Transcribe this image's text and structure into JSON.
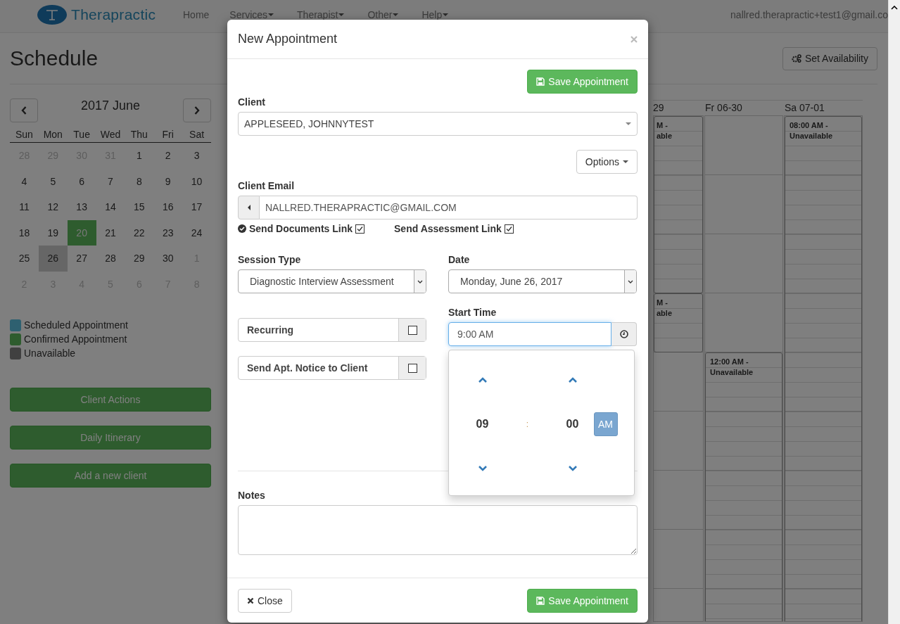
{
  "nav": {
    "brand": "Therapractic",
    "items": [
      {
        "label": "Home",
        "dropdown": false
      },
      {
        "label": "Services",
        "dropdown": true
      },
      {
        "label": "Therapist",
        "dropdown": true
      },
      {
        "label": "Other",
        "dropdown": true
      },
      {
        "label": "Help",
        "dropdown": true
      }
    ],
    "user": "nallred.therapractic+test1@gmail.co"
  },
  "page": {
    "title": "Schedule",
    "set_availability": "Set Availability"
  },
  "mini_calendar": {
    "title": "2017 June",
    "weekdays": [
      "Sun",
      "Mon",
      "Tue",
      "Wed",
      "Thu",
      "Fri",
      "Sat"
    ],
    "weeks": [
      [
        {
          "day": "28",
          "muted": true,
          "today": false,
          "selected": false
        },
        {
          "day": "29",
          "muted": true,
          "today": false,
          "selected": false
        },
        {
          "day": "30",
          "muted": true,
          "today": false,
          "selected": false
        },
        {
          "day": "31",
          "muted": true,
          "today": false,
          "selected": false
        },
        {
          "day": "1",
          "muted": false,
          "today": false,
          "selected": false
        },
        {
          "day": "2",
          "muted": false,
          "today": false,
          "selected": false
        },
        {
          "day": "3",
          "muted": false,
          "today": false,
          "selected": false
        }
      ],
      [
        {
          "day": "4",
          "muted": false,
          "today": false,
          "selected": false
        },
        {
          "day": "5",
          "muted": false,
          "today": false,
          "selected": false
        },
        {
          "day": "6",
          "muted": false,
          "today": false,
          "selected": false
        },
        {
          "day": "7",
          "muted": false,
          "today": false,
          "selected": false
        },
        {
          "day": "8",
          "muted": false,
          "today": false,
          "selected": false
        },
        {
          "day": "9",
          "muted": false,
          "today": false,
          "selected": false
        },
        {
          "day": "10",
          "muted": false,
          "today": false,
          "selected": false
        }
      ],
      [
        {
          "day": "11",
          "muted": false,
          "today": false,
          "selected": false
        },
        {
          "day": "12",
          "muted": false,
          "today": false,
          "selected": false
        },
        {
          "day": "13",
          "muted": false,
          "today": false,
          "selected": false
        },
        {
          "day": "14",
          "muted": false,
          "today": false,
          "selected": false
        },
        {
          "day": "15",
          "muted": false,
          "today": false,
          "selected": false
        },
        {
          "day": "16",
          "muted": false,
          "today": false,
          "selected": false
        },
        {
          "day": "17",
          "muted": false,
          "today": false,
          "selected": false
        }
      ],
      [
        {
          "day": "18",
          "muted": false,
          "today": false,
          "selected": false
        },
        {
          "day": "19",
          "muted": false,
          "today": false,
          "selected": false
        },
        {
          "day": "20",
          "muted": false,
          "today": true,
          "selected": false
        },
        {
          "day": "21",
          "muted": false,
          "today": false,
          "selected": false
        },
        {
          "day": "22",
          "muted": false,
          "today": false,
          "selected": false
        },
        {
          "day": "23",
          "muted": false,
          "today": false,
          "selected": false
        },
        {
          "day": "24",
          "muted": false,
          "today": false,
          "selected": false
        }
      ],
      [
        {
          "day": "25",
          "muted": false,
          "today": false,
          "selected": false
        },
        {
          "day": "26",
          "muted": false,
          "today": false,
          "selected": true
        },
        {
          "day": "27",
          "muted": false,
          "today": false,
          "selected": false
        },
        {
          "day": "28",
          "muted": false,
          "today": false,
          "selected": false
        },
        {
          "day": "29",
          "muted": false,
          "today": false,
          "selected": false
        },
        {
          "day": "30",
          "muted": false,
          "today": false,
          "selected": false
        },
        {
          "day": "1",
          "muted": true,
          "today": false,
          "selected": false
        }
      ],
      [
        {
          "day": "2",
          "muted": true,
          "today": false,
          "selected": false
        },
        {
          "day": "3",
          "muted": true,
          "today": false,
          "selected": false
        },
        {
          "day": "4",
          "muted": true,
          "today": false,
          "selected": false
        },
        {
          "day": "5",
          "muted": true,
          "today": false,
          "selected": false
        },
        {
          "day": "6",
          "muted": true,
          "today": false,
          "selected": false
        },
        {
          "day": "7",
          "muted": true,
          "today": false,
          "selected": false
        },
        {
          "day": "8",
          "muted": true,
          "today": false,
          "selected": false
        }
      ]
    ]
  },
  "legend": [
    {
      "label": "Scheduled Appointment",
      "color": "#2e6070"
    },
    {
      "label": "Confirmed Appointment",
      "color": "#2e5c2e"
    },
    {
      "label": "Unavailable",
      "color": "#404040"
    }
  ],
  "side_buttons": [
    "Client Actions",
    "Daily Itinerary",
    "Add a new client"
  ],
  "week_view": {
    "columns": [
      {
        "header": "29",
        "slots": [
          {
            "kind": "event",
            "text": "M -\nable"
          },
          {
            "kind": "continued"
          },
          {
            "kind": "continued"
          },
          {
            "kind": "event",
            "text": "M -\nable"
          },
          {
            "kind": "free"
          },
          {
            "kind": "free"
          },
          {
            "kind": "free"
          },
          {
            "kind": "free"
          },
          {
            "kind": "free"
          }
        ]
      },
      {
        "header": "Fr 06-30",
        "slots": [
          {
            "kind": "free"
          },
          {
            "kind": "free"
          },
          {
            "kind": "free"
          },
          {
            "kind": "free"
          },
          {
            "kind": "event",
            "text": "12:00 AM - Unavailable"
          },
          {
            "kind": "continued"
          },
          {
            "kind": "continued"
          },
          {
            "kind": "continued"
          },
          {
            "kind": "continued"
          }
        ]
      },
      {
        "header": "Sa 07-01",
        "slots": [
          {
            "kind": "event",
            "text": "08:00 AM - Unavailable"
          },
          {
            "kind": "continued"
          },
          {
            "kind": "continued"
          },
          {
            "kind": "continued"
          },
          {
            "kind": "continued"
          },
          {
            "kind": "continued"
          },
          {
            "kind": "continued"
          },
          {
            "kind": "continued"
          },
          {
            "kind": "continued"
          }
        ]
      }
    ]
  },
  "modal": {
    "title": "New Appointment",
    "save_label": "Save Appointment",
    "client": {
      "label": "Client",
      "value": "APPLESEED, JOHNNYTEST"
    },
    "options_label": "Options",
    "email": {
      "label": "Client Email",
      "value": "NALLRED.THERAPRACTIC@GMAIL.COM"
    },
    "links": [
      {
        "label": "Send Documents Link",
        "checked": true,
        "verified": true
      },
      {
        "label": "Send Assessment Link",
        "checked": true,
        "verified": false
      }
    ],
    "session_type": {
      "label": "Session Type",
      "value": "Diagnostic Interview Assessment"
    },
    "date": {
      "label": "Date",
      "value": "Monday, June 26, 2017"
    },
    "toggles": [
      {
        "label": "Recurring",
        "checked": false
      },
      {
        "label": "Send Apt. Notice to Client",
        "checked": false
      }
    ],
    "start_time": {
      "label": "Start Time",
      "value": "9:00 AM"
    },
    "time_picker": {
      "hours": "09",
      "separator": ":",
      "minutes": "00",
      "period": "AM"
    },
    "notes": {
      "label": "Notes"
    },
    "footer": {
      "close": "Close",
      "save": "Save Appointment"
    }
  }
}
